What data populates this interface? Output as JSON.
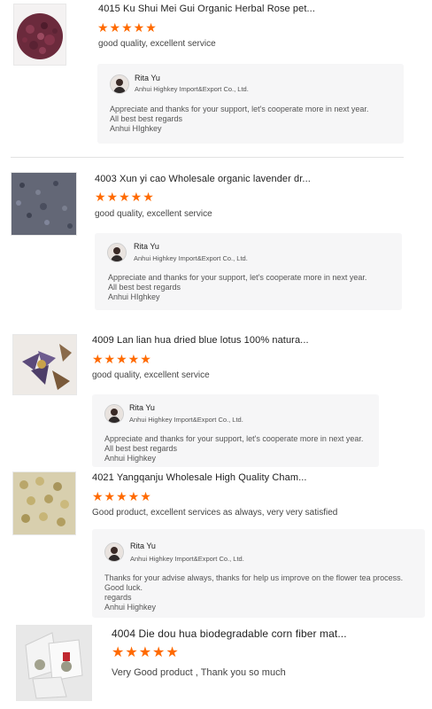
{
  "reviews": [
    {
      "title": "4015 Ku Shui Mei Gui Organic Herbal Rose pet...",
      "stars": "★★★★★",
      "comment": "good quality, excellent service",
      "reply": {
        "name": "Rita Yu",
        "company": "Anhui Highkey Import&Export Co., Ltd.",
        "lines": [
          "Appreciate and thanks for your support, let's cooperate more in next year.",
          "All best best regards",
          "Anhui HIghkey"
        ]
      }
    },
    {
      "title": "4003 Xun yi cao Wholesale organic lavender dr...",
      "stars": "★★★★★",
      "comment": "good quality, excellent service",
      "reply": {
        "name": "Rita Yu",
        "company": "Anhui Highkey Import&Export Co., Ltd.",
        "lines": [
          "Appreciate and thanks for your support, let's cooperate more in next year.",
          "All best best regards",
          "Anhui HIghkey"
        ]
      }
    },
    {
      "title": "4009 Lan lian hua dried blue lotus 100% natura...",
      "stars": "★★★★★",
      "comment": "good quality, excellent service",
      "reply": {
        "name": "Rita Yu",
        "company": "Anhui Highkey Import&Export Co., Ltd.",
        "lines": [
          "Appreciate and thanks for your support, let's cooperate more in next year.",
          "All best best regards",
          "Anhui Highkey"
        ]
      }
    },
    {
      "title": "4021 Yangqanju Wholesale High Quality Cham...",
      "stars": "★★★★★",
      "comment": "Good product, excellent services as always, very very satisfied",
      "reply": {
        "name": "Rita Yu",
        "company": "Anhui Highkey Import&Export Co., Ltd.",
        "lines": [
          "Thanks for your advise always, thanks for help us improve on the flower tea process.",
          "Good luck.",
          "regards",
          "Anhui Highkey"
        ]
      }
    },
    {
      "title": "4004 Die dou hua biodegradable corn fiber mat...",
      "stars": "★★★★★",
      "comment": "Very Good product , Thank you so much"
    }
  ],
  "colors": {
    "star": "#ff6a00",
    "reply_bg": "#f6f6f7"
  },
  "icons": {
    "avatar": "seller-avatar-icon"
  }
}
